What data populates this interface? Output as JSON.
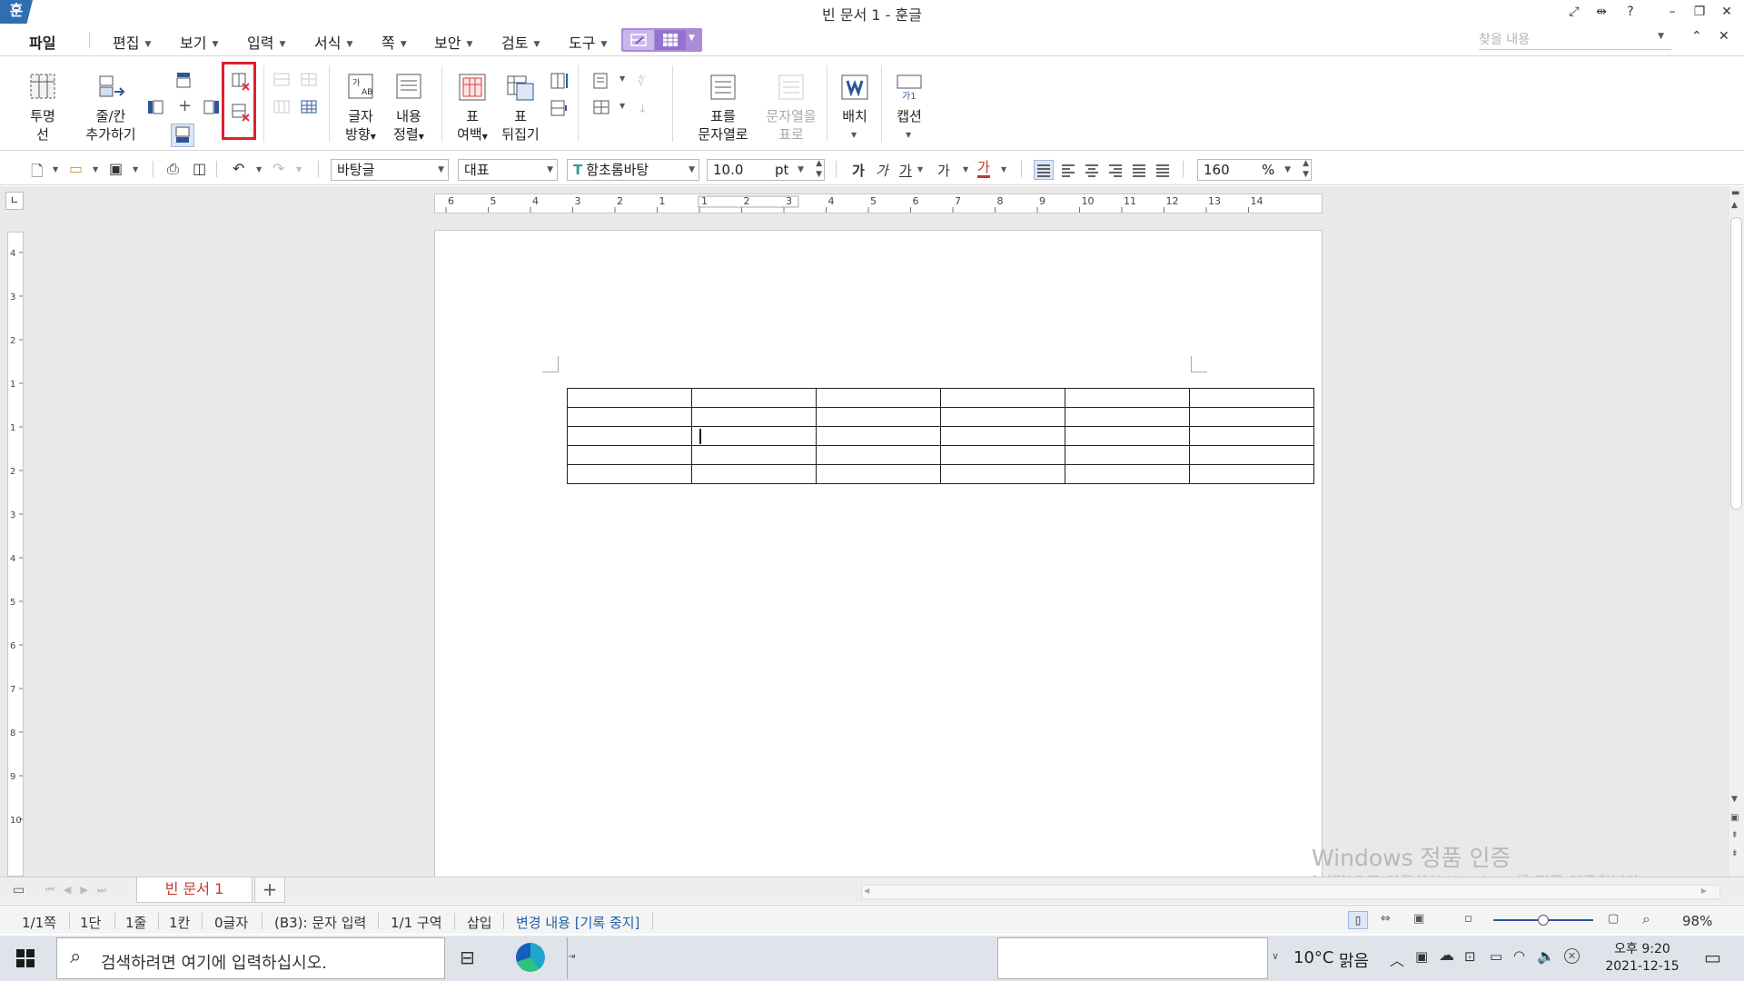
{
  "window": {
    "logo": "훈",
    "title": "빈 문서 1 - 훈글"
  },
  "menu": {
    "file": "파일",
    "items": [
      "편집",
      "보기",
      "입력",
      "서식",
      "쪽",
      "보안",
      "검토",
      "도구"
    ],
    "search_placeholder": "찾을 내용"
  },
  "ribbon": {
    "transparent_line": [
      "투명",
      "선"
    ],
    "add_row_col": [
      "줄/칸",
      "추가하기"
    ],
    "text_direction": [
      "글자",
      "방향"
    ],
    "content_align": [
      "내용",
      "정렬"
    ],
    "table_margin": [
      "표",
      "여백"
    ],
    "table_flip": [
      "표",
      "뒤집기"
    ],
    "table_to_text": [
      "표를",
      "문자열로"
    ],
    "text_to_table": [
      "문자열을",
      "표로"
    ],
    "arrange": "배치",
    "caption": "캡션"
  },
  "toolbar": {
    "style": "바탕글",
    "lang": "대표",
    "font": "함초롬바탕",
    "font_size": "10.0",
    "font_unit": "pt",
    "spacing": "160",
    "spacing_unit": "%",
    "format_glyphs": [
      "가",
      "가",
      "가",
      "가",
      "가"
    ]
  },
  "ruler": {
    "h_ticks": [
      "6",
      "5",
      "4",
      "3",
      "2",
      "1",
      "1",
      "2",
      "3",
      "4",
      "5",
      "6",
      "7",
      "8",
      "9",
      "10",
      "11",
      "12",
      "13",
      "14"
    ],
    "v_ticks": [
      "4",
      "3",
      "2",
      "1",
      "1",
      "2",
      "3",
      "4",
      "5",
      "6",
      "7",
      "8",
      "9",
      "10"
    ]
  },
  "table": {
    "rows": 5,
    "cols": 6
  },
  "watermark": {
    "line1": "Windows 정품 인증",
    "line2": "[설정]으로 이동하여 Windows를 정품 인증합니다."
  },
  "tabs": {
    "doc_tab": "빈 문서 1",
    "add_tab": "+"
  },
  "status": {
    "page": "1/1쪽",
    "column": "1단",
    "line": "1줄",
    "cell_col": "1칸",
    "chars": "0글자",
    "cell": "(B3): 문자 입력",
    "section": "1/1 구역",
    "mode": "삽입",
    "track": "변경 내용 [기록 중지]",
    "zoom": "98%",
    "zoom_level": 0.5
  },
  "taskbar": {
    "search_placeholder": "검색하려면 여기에 입력하십시오.",
    "weather_temp": "10°C",
    "weather_text": "맑음",
    "time": "오후 9:20",
    "date": "2021-12-15"
  }
}
